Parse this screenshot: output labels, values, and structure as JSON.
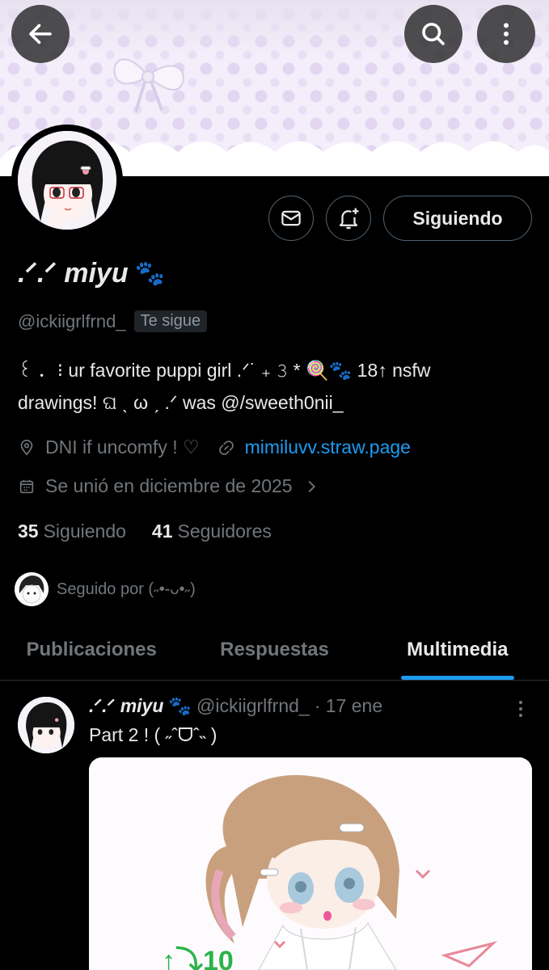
{
  "header": {
    "back_icon": "arrow-left-icon",
    "search_icon": "search-icon",
    "more_icon": "more-vertical-icon"
  },
  "profile": {
    "display_name": ".ᐟ.ᐟ miyu",
    "name_emoji": "🐾",
    "handle": "@ickiigrlfrnd_",
    "follows_you_badge": "Te sigue",
    "bio_line1": "꒰ ． ⁝ ur favorite puppi girl .ᐟ˙ ₊ 𝟹 * 🍭🐾 18↑ nsfw",
    "bio_line2": "drawings! ଘ ˎ ω ˏ .ᐟ was @/sweeth0nii_",
    "location": "DNI if uncomfy ! ♡",
    "website": "mimiluvv.straw.page",
    "joined": "Se unió en diciembre de 2025",
    "following_count": "35",
    "following_label": "Siguiendo",
    "followers_count": "41",
    "followers_label": "Seguidores",
    "followed_by": "Seguido por (˶•-ᴗ•˶)"
  },
  "actions": {
    "message_icon": "mail-icon",
    "notify_icon": "bell-plus-icon",
    "follow_label": "Siguiendo"
  },
  "tabs": [
    {
      "label": "Publicaciones",
      "active": false
    },
    {
      "label": "Respuestas",
      "active": false
    },
    {
      "label": "Multimedia",
      "active": true
    }
  ],
  "post": {
    "display_name": ".ᐟ.ᐟ miyu",
    "name_emoji": "🐾",
    "handle": "@ickiigrlfrnd_",
    "date": "· 17 ene",
    "text": "Part 2 ! ( ˶ˆᗜˆ˵ )"
  },
  "colors": {
    "accent": "#1d9bf0",
    "muted": "#71767b",
    "text": "#e7e9ea",
    "background": "#000000"
  }
}
